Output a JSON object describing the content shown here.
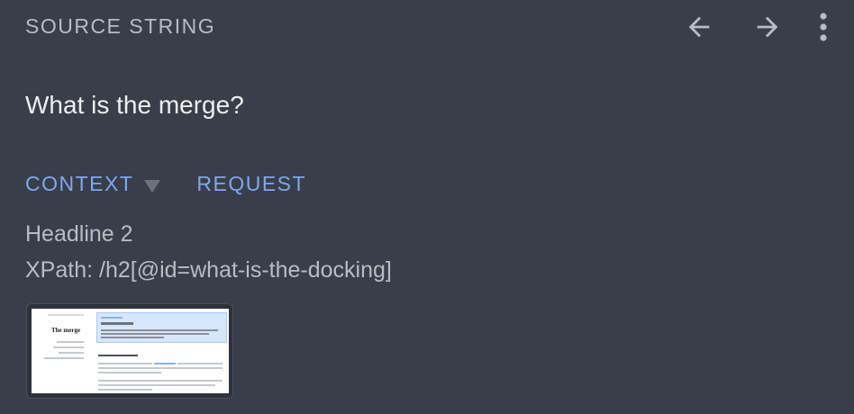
{
  "header": {
    "label": "SOURCE STRING",
    "icons": [
      "arrow-back-icon",
      "arrow-forward-icon",
      "more-vert-icon"
    ]
  },
  "source": {
    "text": "What is the merge?"
  },
  "tabs": {
    "context_label": "CONTEXT",
    "request_label": "REQUEST"
  },
  "context": {
    "element_type": "Headline 2",
    "xpath": "XPath: /h2[@id=what-is-the-docking]"
  },
  "screenshot_thumbnail": {
    "title": "The merge",
    "heading": "What is the merge?"
  },
  "colors": {
    "background": "#393e49",
    "accent": "#7fa7f0",
    "muted_text": "#b8bcc4",
    "primary_text": "#eceef2"
  }
}
